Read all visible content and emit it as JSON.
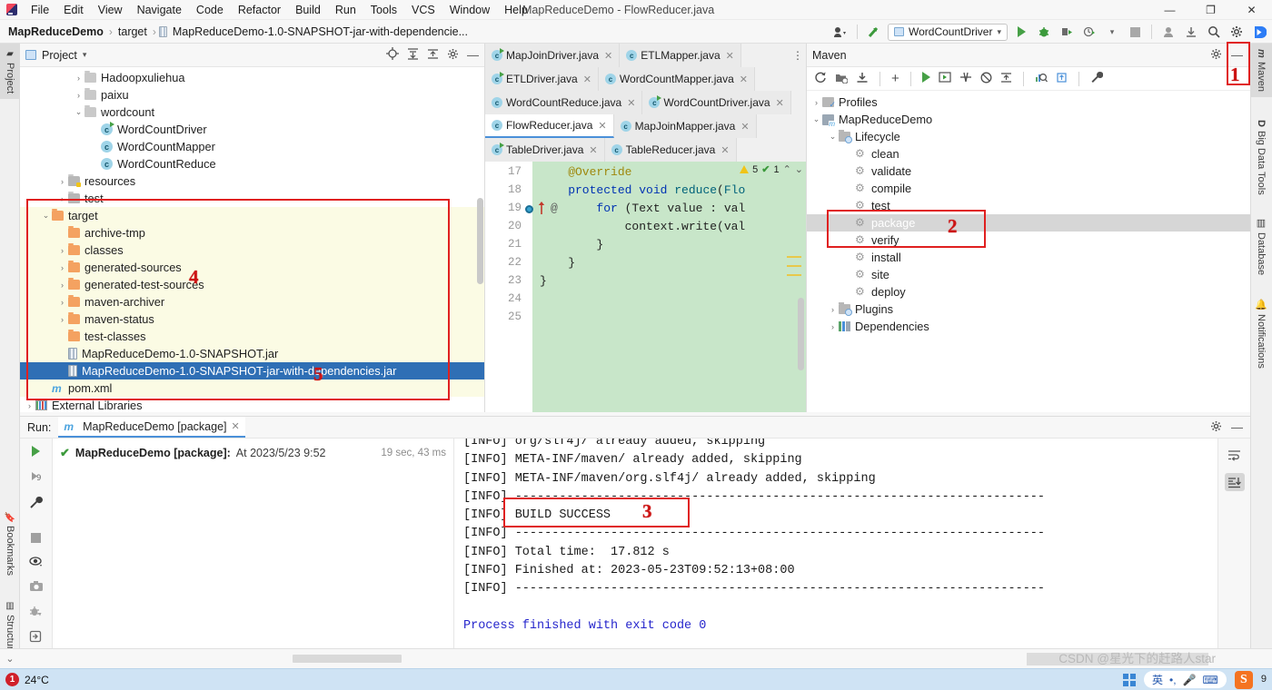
{
  "window": {
    "title": "MapReduceDemo - FlowReducer.java",
    "minimize": "—",
    "maximize": "❐",
    "close": "✕"
  },
  "menu": [
    "File",
    "Edit",
    "View",
    "Navigate",
    "Code",
    "Refactor",
    "Build",
    "Run",
    "Tools",
    "VCS",
    "Window",
    "Help"
  ],
  "breadcrumb": {
    "project": "MapReduceDemo",
    "folder": "target",
    "file": "MapReduceDemo-1.0-SNAPSHOT-jar-with-dependencie...",
    "sep": "›"
  },
  "toolbar": {
    "run_config": "WordCountDriver",
    "dropdown_caret": "▾",
    "icons": [
      "user-avatar-icon",
      "update-project-icon",
      "run-icon",
      "debug-icon",
      "run-coverage-icon",
      "profiler-icon",
      "stop-icon",
      "account-icon",
      "download-icon",
      "search-icon",
      "settings-icon",
      "idea-icon"
    ]
  },
  "left_strip": [
    {
      "label": "Project",
      "selected": true
    },
    {
      "label": "Bookmarks",
      "selected": false
    },
    {
      "label": "Structure",
      "selected": false
    }
  ],
  "right_strip": [
    {
      "label": "Maven",
      "selected": true
    },
    {
      "label": "Big Data Tools",
      "selected": false
    },
    {
      "label": "Database",
      "selected": false
    },
    {
      "label": "Notifications",
      "selected": false
    }
  ],
  "project_panel": {
    "title": "Project",
    "caret": "▾",
    "actions": [
      "locate-icon",
      "expand-all-icon",
      "collapse-all-icon",
      "settings-icon",
      "hide-icon"
    ],
    "tree": [
      {
        "label": "Hadoopxuliehua",
        "type": "folder",
        "indent": 2,
        "arrow": "›"
      },
      {
        "label": "paixu",
        "type": "folder",
        "indent": 2,
        "arrow": "›"
      },
      {
        "label": "wordcount",
        "type": "folder",
        "indent": 2,
        "arrow": "⌄"
      },
      {
        "label": "WordCountDriver",
        "type": "class-run",
        "indent": 3,
        "arrow": ""
      },
      {
        "label": "WordCountMapper",
        "type": "class",
        "indent": 3,
        "arrow": ""
      },
      {
        "label": "WordCountReduce",
        "type": "class",
        "indent": 3,
        "arrow": ""
      },
      {
        "label": "resources",
        "type": "folder-res",
        "indent": 1,
        "arrow": "›"
      },
      {
        "label": "test",
        "type": "folder-src",
        "indent": 1,
        "arrow": "›"
      },
      {
        "label": "target",
        "type": "folder-orange",
        "indent": 0,
        "arrow": "⌄"
      },
      {
        "label": "archive-tmp",
        "type": "folder-orange",
        "indent": 1,
        "arrow": ""
      },
      {
        "label": "classes",
        "type": "folder-orange",
        "indent": 1,
        "arrow": "›"
      },
      {
        "label": "generated-sources",
        "type": "folder-orange",
        "indent": 1,
        "arrow": "›"
      },
      {
        "label": "generated-test-sources",
        "type": "folder-orange",
        "indent": 1,
        "arrow": "›"
      },
      {
        "label": "maven-archiver",
        "type": "folder-orange",
        "indent": 1,
        "arrow": "›"
      },
      {
        "label": "maven-status",
        "type": "folder-orange",
        "indent": 1,
        "arrow": "›"
      },
      {
        "label": "test-classes",
        "type": "folder-orange",
        "indent": 1,
        "arrow": ""
      },
      {
        "label": "MapReduceDemo-1.0-SNAPSHOT.jar",
        "type": "jar",
        "indent": 1,
        "arrow": ""
      },
      {
        "label": "MapReduceDemo-1.0-SNAPSHOT-jar-with-dependencies.jar",
        "type": "jar",
        "indent": 1,
        "arrow": "",
        "selected": true
      },
      {
        "label": "pom.xml",
        "type": "maven-file",
        "indent": 0,
        "arrow": ""
      },
      {
        "label": "External Libraries",
        "type": "library",
        "indent": -1,
        "arrow": "›"
      }
    ]
  },
  "editor": {
    "tab_rows": [
      [
        {
          "label": "MapJoinDriver.java",
          "icon": "class-run"
        },
        {
          "label": "ETLMapper.java",
          "icon": "class"
        }
      ],
      [
        {
          "label": "ETLDriver.java",
          "icon": "class-run"
        },
        {
          "label": "WordCountMapper.java",
          "icon": "class"
        }
      ],
      [
        {
          "label": "WordCountReduce.java",
          "icon": "class"
        },
        {
          "label": "WordCountDriver.java",
          "icon": "class-run"
        }
      ],
      [
        {
          "label": "FlowReducer.java",
          "icon": "class",
          "active": true
        },
        {
          "label": "MapJoinMapper.java",
          "icon": "class"
        }
      ],
      [
        {
          "label": "TableDriver.java",
          "icon": "class-run"
        },
        {
          "label": "TableReducer.java",
          "icon": "class"
        }
      ]
    ],
    "more_icon": "⋮",
    "close_icon": "✕",
    "lines": [
      {
        "n": "17",
        "text": "    @Override",
        "kind": "anno"
      },
      {
        "n": "18",
        "text": "    protected void reduce(Flo",
        "kind": "sig"
      },
      {
        "n": "19",
        "text": "        for (Text value : val",
        "kind": "for"
      },
      {
        "n": "20",
        "text": "            context.write(val",
        "kind": "plain"
      },
      {
        "n": "21",
        "text": "        }",
        "kind": "plain"
      },
      {
        "n": "22",
        "text": "    }",
        "kind": "plain"
      },
      {
        "n": "23",
        "text": "}",
        "kind": "plain"
      },
      {
        "n": "24",
        "text": "",
        "kind": "plain"
      },
      {
        "n": "25",
        "text": "",
        "kind": "plain"
      }
    ],
    "inspection": {
      "warnings": "5",
      "checks": "1",
      "up": "⌃",
      "down": "⌄"
    },
    "gutter_marks": [
      "breakpoint-icon",
      "override-arrow-icon",
      "annotation-icon"
    ]
  },
  "maven_panel": {
    "title": "Maven",
    "actions": [
      "settings-icon",
      "hide-icon"
    ],
    "toolbar_icons": [
      "reload-icon",
      "generate-sources-icon",
      "download-sources-icon",
      "add-icon",
      "run-icon",
      "execute-goal-icon",
      "skip-tests-icon",
      "offline-mode-icon",
      "collapse-all-icon",
      "show-diagram-icon",
      "expand-icon",
      "settings-wrench-icon"
    ],
    "tree": [
      {
        "label": "Profiles",
        "type": "profiles",
        "indent": 0,
        "arrow": "›"
      },
      {
        "label": "MapReduceDemo",
        "type": "module",
        "indent": 0,
        "arrow": "⌄"
      },
      {
        "label": "Lifecycle",
        "type": "mvfolder",
        "indent": 1,
        "arrow": "⌄"
      },
      {
        "label": "clean",
        "type": "goal",
        "indent": 2,
        "arrow": ""
      },
      {
        "label": "validate",
        "type": "goal",
        "indent": 2,
        "arrow": ""
      },
      {
        "label": "compile",
        "type": "goal",
        "indent": 2,
        "arrow": ""
      },
      {
        "label": "test",
        "type": "goal",
        "indent": 2,
        "arrow": ""
      },
      {
        "label": "package",
        "type": "goal",
        "indent": 2,
        "arrow": "",
        "selected": true
      },
      {
        "label": "verify",
        "type": "goal",
        "indent": 2,
        "arrow": ""
      },
      {
        "label": "install",
        "type": "goal",
        "indent": 2,
        "arrow": ""
      },
      {
        "label": "site",
        "type": "goal",
        "indent": 2,
        "arrow": ""
      },
      {
        "label": "deploy",
        "type": "goal",
        "indent": 2,
        "arrow": ""
      },
      {
        "label": "Plugins",
        "type": "mvfolder",
        "indent": 1,
        "arrow": "›"
      },
      {
        "label": "Dependencies",
        "type": "dependencies",
        "indent": 1,
        "arrow": "›"
      }
    ]
  },
  "run_panel": {
    "label": "Run:",
    "tab": "MapReduceDemo [package]",
    "close_icon": "✕",
    "actions": [
      "settings-icon",
      "hide-icon"
    ],
    "left_tools": [
      "rerun-icon",
      "rerun-failed-icon",
      "wrench-icon",
      "stop-icon",
      "toggle-visibility-icon",
      "screenshot-icon",
      "debug-icon",
      "export-icon",
      "expand-more-icon"
    ],
    "right_tools": [
      "soft-wrap-icon",
      "scroll-to-end-icon"
    ],
    "tree": {
      "status_icon": "check-icon",
      "name": "MapReduceDemo [package]:",
      "timestamp": "At 2023/5/23 9:52",
      "duration": "19 sec, 43 ms"
    },
    "console": [
      {
        "text": "[INFO] org/slf4j/ already added, skipping",
        "style": "plain"
      },
      {
        "text": "[INFO] META-INF/maven/ already added, skipping",
        "style": "plain"
      },
      {
        "text": "[INFO] META-INF/maven/org.slf4j/ already added, skipping",
        "style": "plain"
      },
      {
        "text": "[INFO] ------------------------------------------------------------------------",
        "style": "plain"
      },
      {
        "text": "[INFO] BUILD SUCCESS",
        "style": "plain"
      },
      {
        "text": "[INFO] ------------------------------------------------------------------------",
        "style": "plain"
      },
      {
        "text": "[INFO] Total time:  17.812 s",
        "style": "plain"
      },
      {
        "text": "[INFO] Finished at: 2023-05-23T09:52:13+08:00",
        "style": "plain"
      },
      {
        "text": "[INFO] ------------------------------------------------------------------------",
        "style": "plain"
      },
      {
        "text": "",
        "style": "plain"
      },
      {
        "text": "Process finished with exit code 0",
        "style": "blue"
      }
    ]
  },
  "annotations": [
    {
      "id": "1",
      "target": "maven-tool-window-tab"
    },
    {
      "id": "2",
      "target": "maven-goal-package"
    },
    {
      "id": "3",
      "target": "console-build-success"
    },
    {
      "id": "4",
      "target": "project-target-folder"
    },
    {
      "id": "5",
      "target": "jar-with-dependencies"
    }
  ],
  "taskbar": {
    "weather": "24°C",
    "badge": "1",
    "ime_lang": "英",
    "ime_punct": "•,",
    "ime_mic": "🎤",
    "ime_kb": "⌨",
    "clock_time": "9"
  },
  "watermark": "CSDN @星光下的赶路人star",
  "colors": {
    "accent": "#4a90d9",
    "selection": "#2f6fb5",
    "annotation": "#e02020",
    "code_bg": "#c8e6c9",
    "highlight_bg": "#fbfbe4",
    "success": "#46a046"
  }
}
